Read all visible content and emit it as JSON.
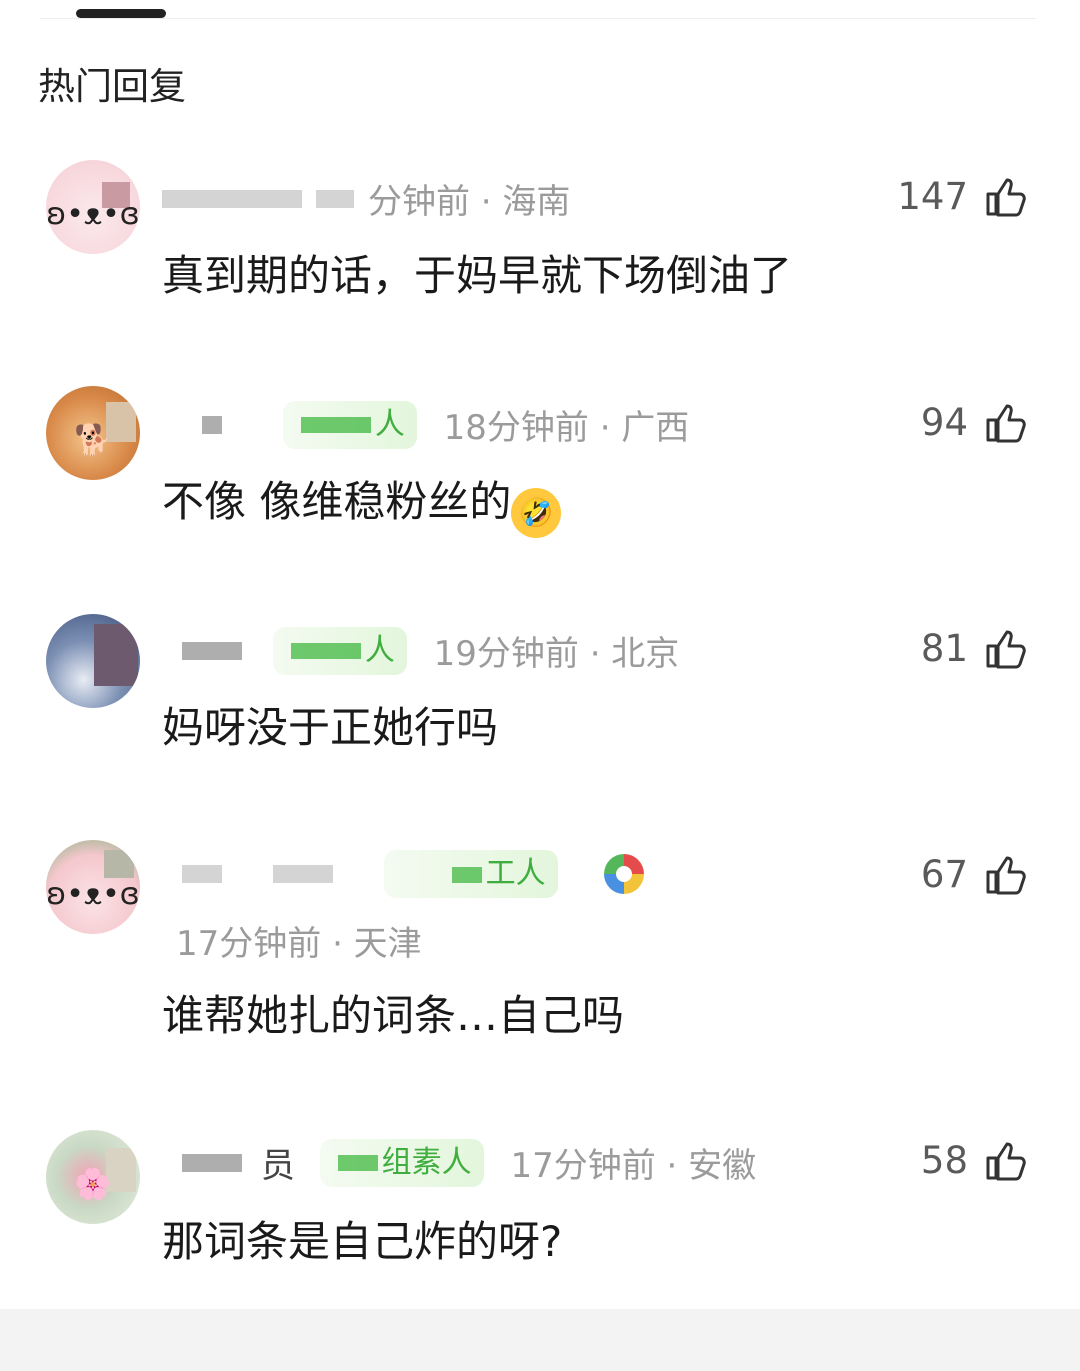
{
  "section_title": "热门回复",
  "comments": [
    {
      "meta": "分钟前 · 海南",
      "likes": "147",
      "text": "真到期的话，于妈早就下场倒油了",
      "avatar": "cartoon-bunny-avatar"
    },
    {
      "badge": "人",
      "meta": "18分钟前 · 广西",
      "likes": "94",
      "text": "不像 像维稳粉丝的",
      "emoji": "rolling-on-floor-laughing-emoji",
      "emoji_glyph": "🤣",
      "avatar": "fluffy-dog-avatar"
    },
    {
      "badge": "人",
      "meta": "19分钟前 · 北京",
      "likes": "81",
      "text": "妈呀没于正她行吗",
      "avatar": "night-sky-avatar"
    },
    {
      "badge": "工人",
      "meta": "17分钟前 · 天津",
      "likes": "67",
      "text": "谁帮她扎的词条…自己吗",
      "avatar": "watermelon-bunny-avatar",
      "extra_icon": "colorful-badge-icon"
    },
    {
      "name_partial": "员",
      "badge": "组素人",
      "meta": "17分钟前 · 安徽",
      "likes": "58",
      "text": "那词条是自己炸的呀?",
      "avatar": "peony-flower-avatar"
    }
  ],
  "like_icon": "thumbs-up-icon",
  "colors": {
    "badge_text": "#3fae3f",
    "meta_gray": "#9b9b9b",
    "text": "#1a1a1a"
  }
}
